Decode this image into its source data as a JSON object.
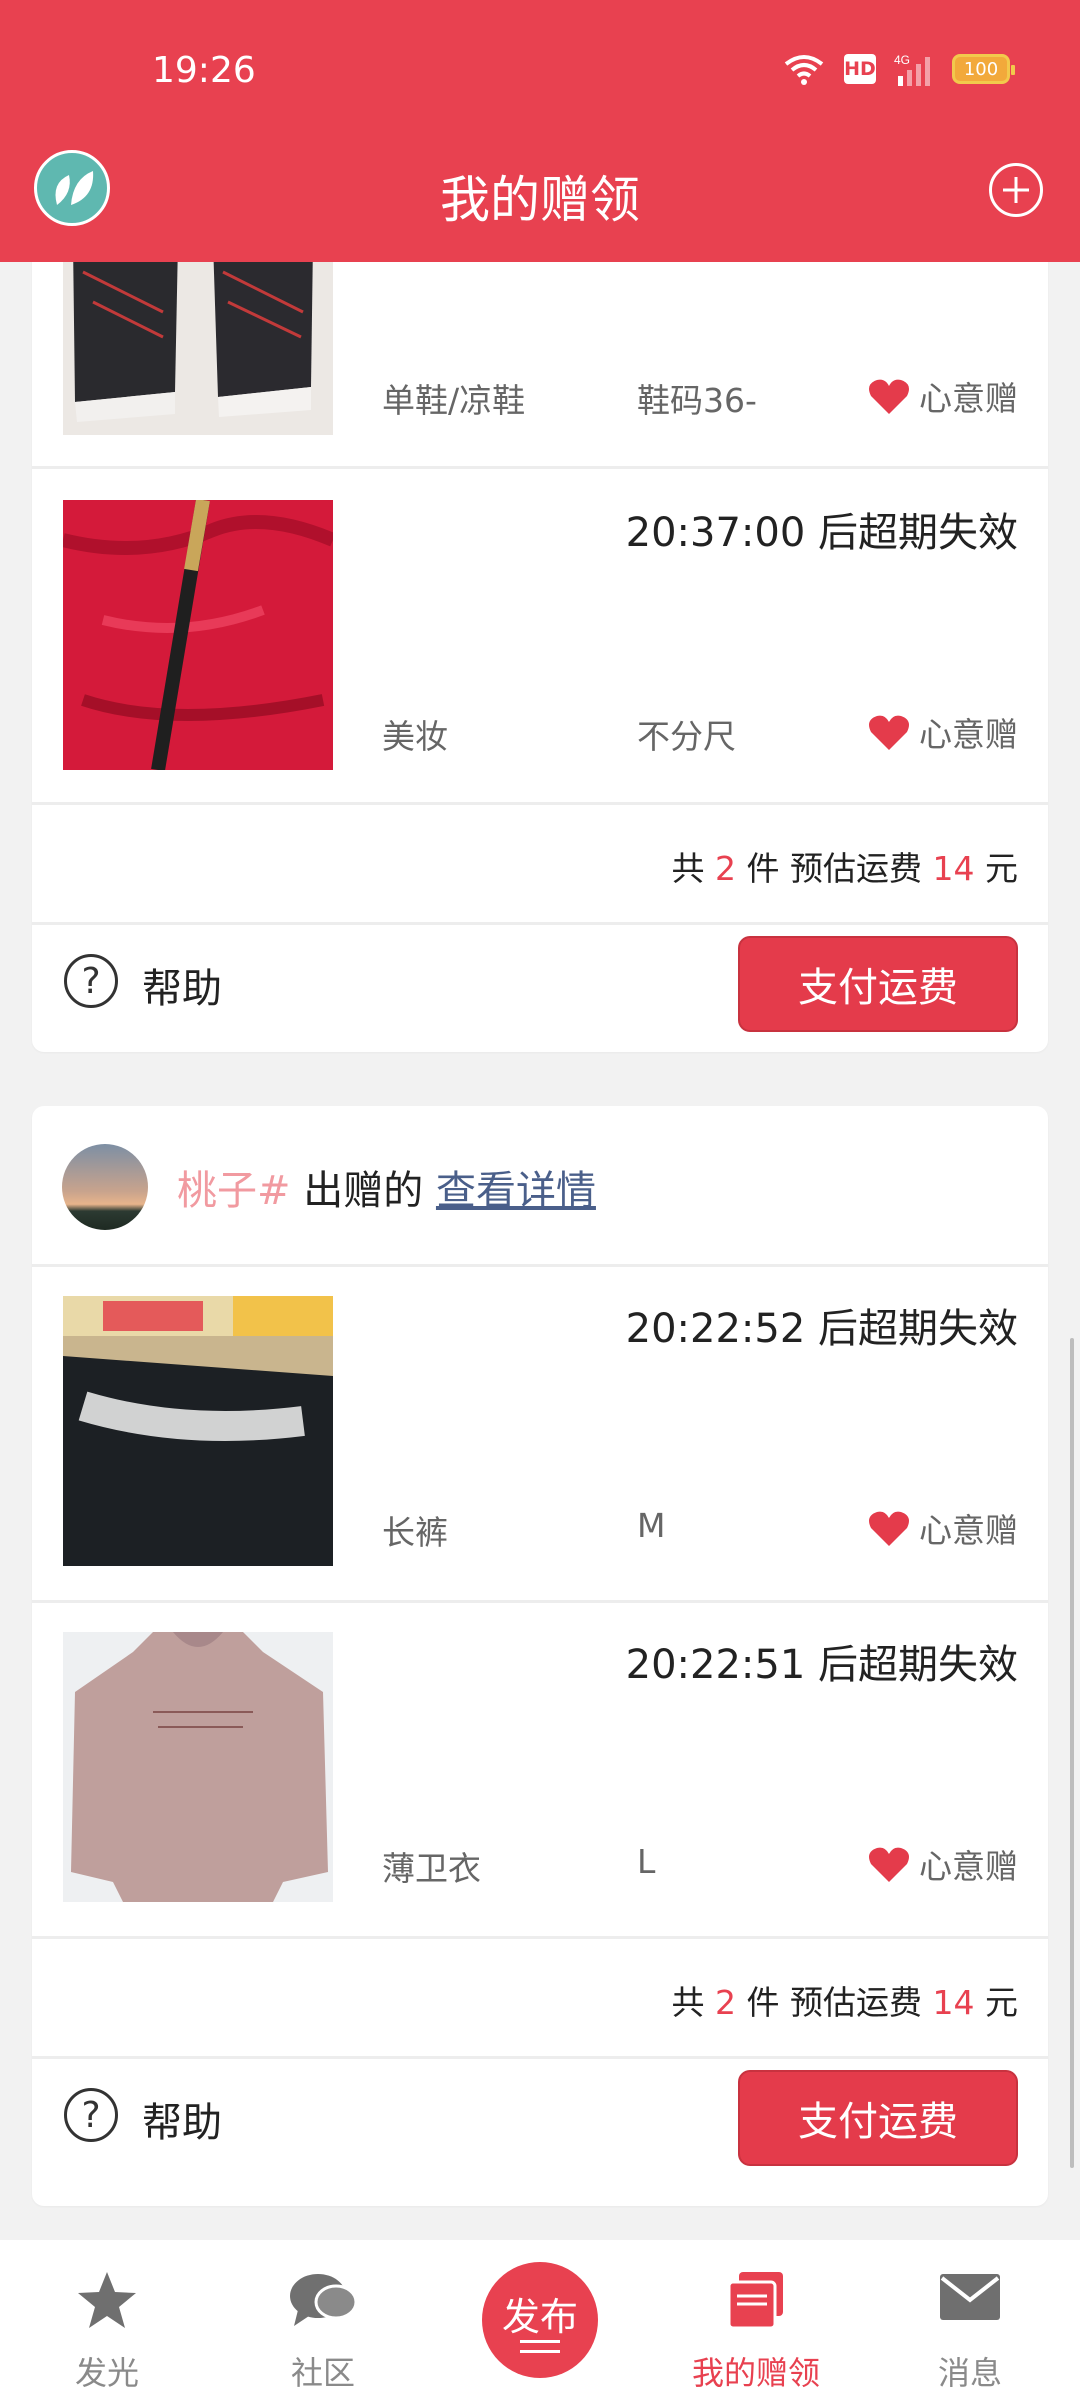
{
  "status_bar": {
    "time": "19:26",
    "battery": "100",
    "hd_label": "HD",
    "network": "4G"
  },
  "header": {
    "title": "我的赠领"
  },
  "card1": {
    "items": [
      {
        "category": "单鞋/凉鞋",
        "size": "鞋码36-",
        "tag": "心意赠"
      },
      {
        "expiry": "20:37:00 后超期失效",
        "category": "美妆",
        "size": "不分尺",
        "tag": "心意赠"
      }
    ],
    "summary": {
      "prefix": "共",
      "count": "2",
      "unit": "件 预估运费",
      "fee": "14",
      "currency": "元"
    },
    "help_label": "帮助",
    "pay_label": "支付运费"
  },
  "card2": {
    "donor_name": "桃子#",
    "donated_text": "出赠的",
    "detail_link": "查看详情",
    "items": [
      {
        "expiry": "20:22:52 后超期失效",
        "category": "长裤",
        "size": "M",
        "tag": "心意赠"
      },
      {
        "expiry": "20:22:51 后超期失效",
        "category": "薄卫衣",
        "size": "L",
        "tag": "心意赠"
      }
    ],
    "summary": {
      "prefix": "共",
      "count": "2",
      "unit": "件 预估运费",
      "fee": "14",
      "currency": "元"
    },
    "help_label": "帮助",
    "pay_label": "支付运费"
  },
  "nav": {
    "items": [
      {
        "label": "发光",
        "icon": "star-icon"
      },
      {
        "label": "社区",
        "icon": "chat-icon"
      },
      {
        "label": "发布",
        "icon": "publish-icon"
      },
      {
        "label": "我的赠领",
        "icon": "gift-book-icon"
      },
      {
        "label": "消息",
        "icon": "mail-icon"
      }
    ],
    "active": "我的赠领"
  },
  "colors": {
    "brand": "#e84150",
    "link": "#4a5f8a",
    "donor_name": "#f19aa0"
  }
}
